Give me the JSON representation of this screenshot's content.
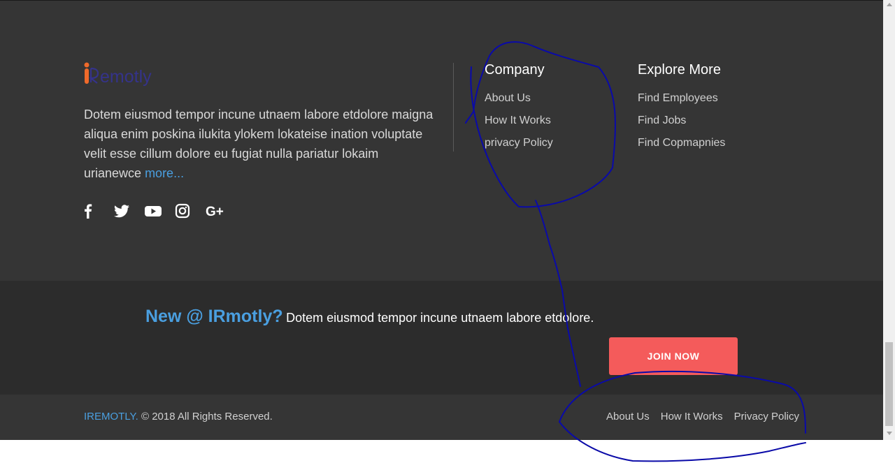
{
  "footer": {
    "logo_text": "iRemotly",
    "about_text": "Dotem eiusmod tempor incune utnaem labore etdolore maigna aliqua enim poskina ilukita ylokem lokateise ination voluptate velit esse cillum dolore eu fugiat nulla pariatur lokaim urianewce",
    "more_link": "more...",
    "social": [
      "facebook-icon",
      "twitter-icon",
      "youtube-icon",
      "instagram-icon",
      "google-plus-icon"
    ],
    "company": {
      "title": "Company",
      "links": [
        "About Us",
        "How It Works",
        "privacy Policy"
      ]
    },
    "explore": {
      "title": "Explore More",
      "links": [
        "Find Employees",
        "Find Jobs",
        "Find Copmapnies"
      ]
    }
  },
  "newsletter": {
    "heading": "New @ IRmotly?",
    "text": "Dotem eiusmod tempor incune utnaem labore etdolore.",
    "button": "JOIN NOW"
  },
  "bottom": {
    "brand": "IREMOTLY.",
    "copyright": "© 2018 All Rights Reserved.",
    "links": [
      "About Us",
      "How It Works",
      "Privacy Policy"
    ]
  },
  "colors": {
    "accent_blue": "#4a9fe0",
    "cta_red": "#f45b5b",
    "footer_bg": "#353535",
    "newsletter_bg": "#2c2c2c",
    "annotation_ink": "#0a0aa8"
  }
}
